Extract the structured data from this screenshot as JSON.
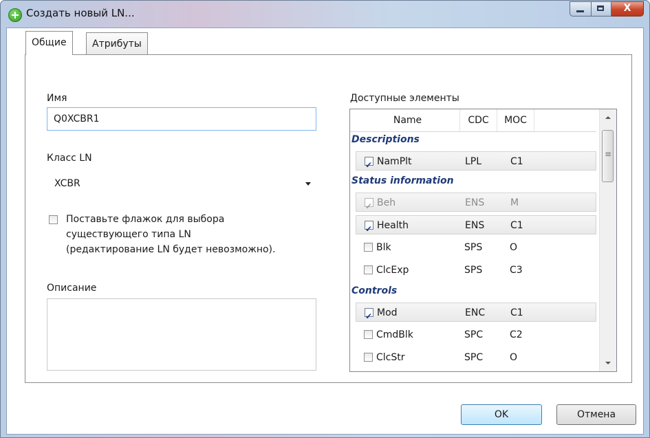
{
  "window": {
    "title": "Создать новый LN..."
  },
  "tabs": [
    {
      "label": "Общие",
      "active": true
    },
    {
      "label": "Атрибуты",
      "active": false
    }
  ],
  "form": {
    "name_label": "Имя",
    "name_value": "Q0XCBR1",
    "class_label": "Класс LN",
    "class_value": "XCBR",
    "existing_type_checkbox": {
      "checked": false,
      "lines": [
        "Поставьте флажок для выбора",
        "существующего типа LN",
        "(редактирование LN будет невозможно)."
      ]
    },
    "description_label": "Описание",
    "description_value": ""
  },
  "elements": {
    "label": "Доступные элементы",
    "columns": [
      "Name",
      "CDC",
      "MOC"
    ],
    "groups": [
      {
        "title": "Descriptions",
        "rows": [
          {
            "name": "NamPlt",
            "cdc": "LPL",
            "moc": "C1",
            "checked": true,
            "disabled": false
          }
        ]
      },
      {
        "title": "Status information",
        "rows": [
          {
            "name": "Beh",
            "cdc": "ENS",
            "moc": "M",
            "checked": true,
            "disabled": true
          },
          {
            "name": "Health",
            "cdc": "ENS",
            "moc": "C1",
            "checked": true,
            "disabled": false
          },
          {
            "name": "Blk",
            "cdc": "SPS",
            "moc": "O",
            "checked": false,
            "disabled": false
          },
          {
            "name": "ClcExp",
            "cdc": "SPS",
            "moc": "C3",
            "checked": false,
            "disabled": false
          }
        ]
      },
      {
        "title": "Controls",
        "rows": [
          {
            "name": "Mod",
            "cdc": "ENC",
            "moc": "C1",
            "checked": true,
            "disabled": false
          },
          {
            "name": "CmdBlk",
            "cdc": "SPC",
            "moc": "C2",
            "checked": false,
            "disabled": false
          },
          {
            "name": "ClcStr",
            "cdc": "SPC",
            "moc": "O",
            "checked": false,
            "disabled": false
          }
        ]
      }
    ]
  },
  "buttons": {
    "ok": "OK",
    "cancel": "Отмена"
  }
}
